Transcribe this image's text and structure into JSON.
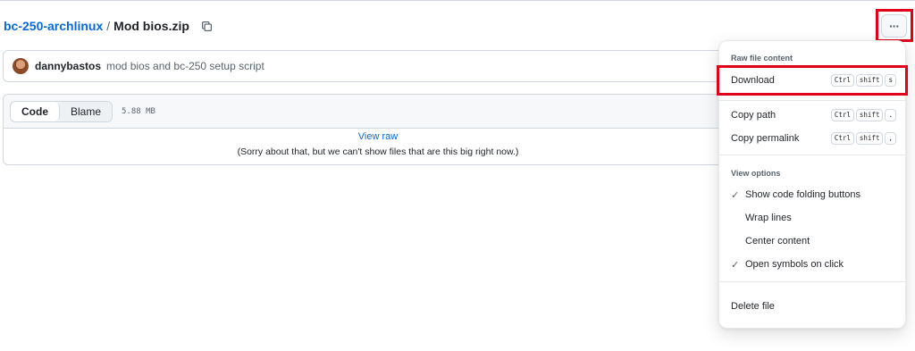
{
  "breadcrumb": {
    "repo": "bc-250-archlinux",
    "separator": "/",
    "file": "Mod bios.zip"
  },
  "commit": {
    "author": "dannybastos",
    "message": "mod bios and bc-250 setup script"
  },
  "file_view": {
    "tabs": [
      "Code",
      "Blame"
    ],
    "active_tab": "Code",
    "size": "5.88 MB",
    "view_raw": "View raw",
    "notice": "(Sorry about that, but we can't show files that are this big right now.)"
  },
  "more_button": {
    "label": "···"
  },
  "menu": {
    "raw_section_title": "Raw file content",
    "download": {
      "label": "Download",
      "keys": [
        "Ctrl",
        "shift",
        "s"
      ]
    },
    "copy_path": {
      "label": "Copy path",
      "keys": [
        "Ctrl",
        "shift",
        "."
      ]
    },
    "copy_permalink": {
      "label": "Copy permalink",
      "keys": [
        "Ctrl",
        "shift",
        ","
      ]
    },
    "view_section_title": "View options",
    "view_options": [
      {
        "label": "Show code folding buttons",
        "checked": true
      },
      {
        "label": "Wrap lines",
        "checked": false
      },
      {
        "label": "Center content",
        "checked": false
      },
      {
        "label": "Open symbols on click",
        "checked": true
      }
    ],
    "delete": "Delete file"
  },
  "colors": {
    "link": "#0969da",
    "highlight": "#e1001a",
    "border": "#d0d7de"
  }
}
